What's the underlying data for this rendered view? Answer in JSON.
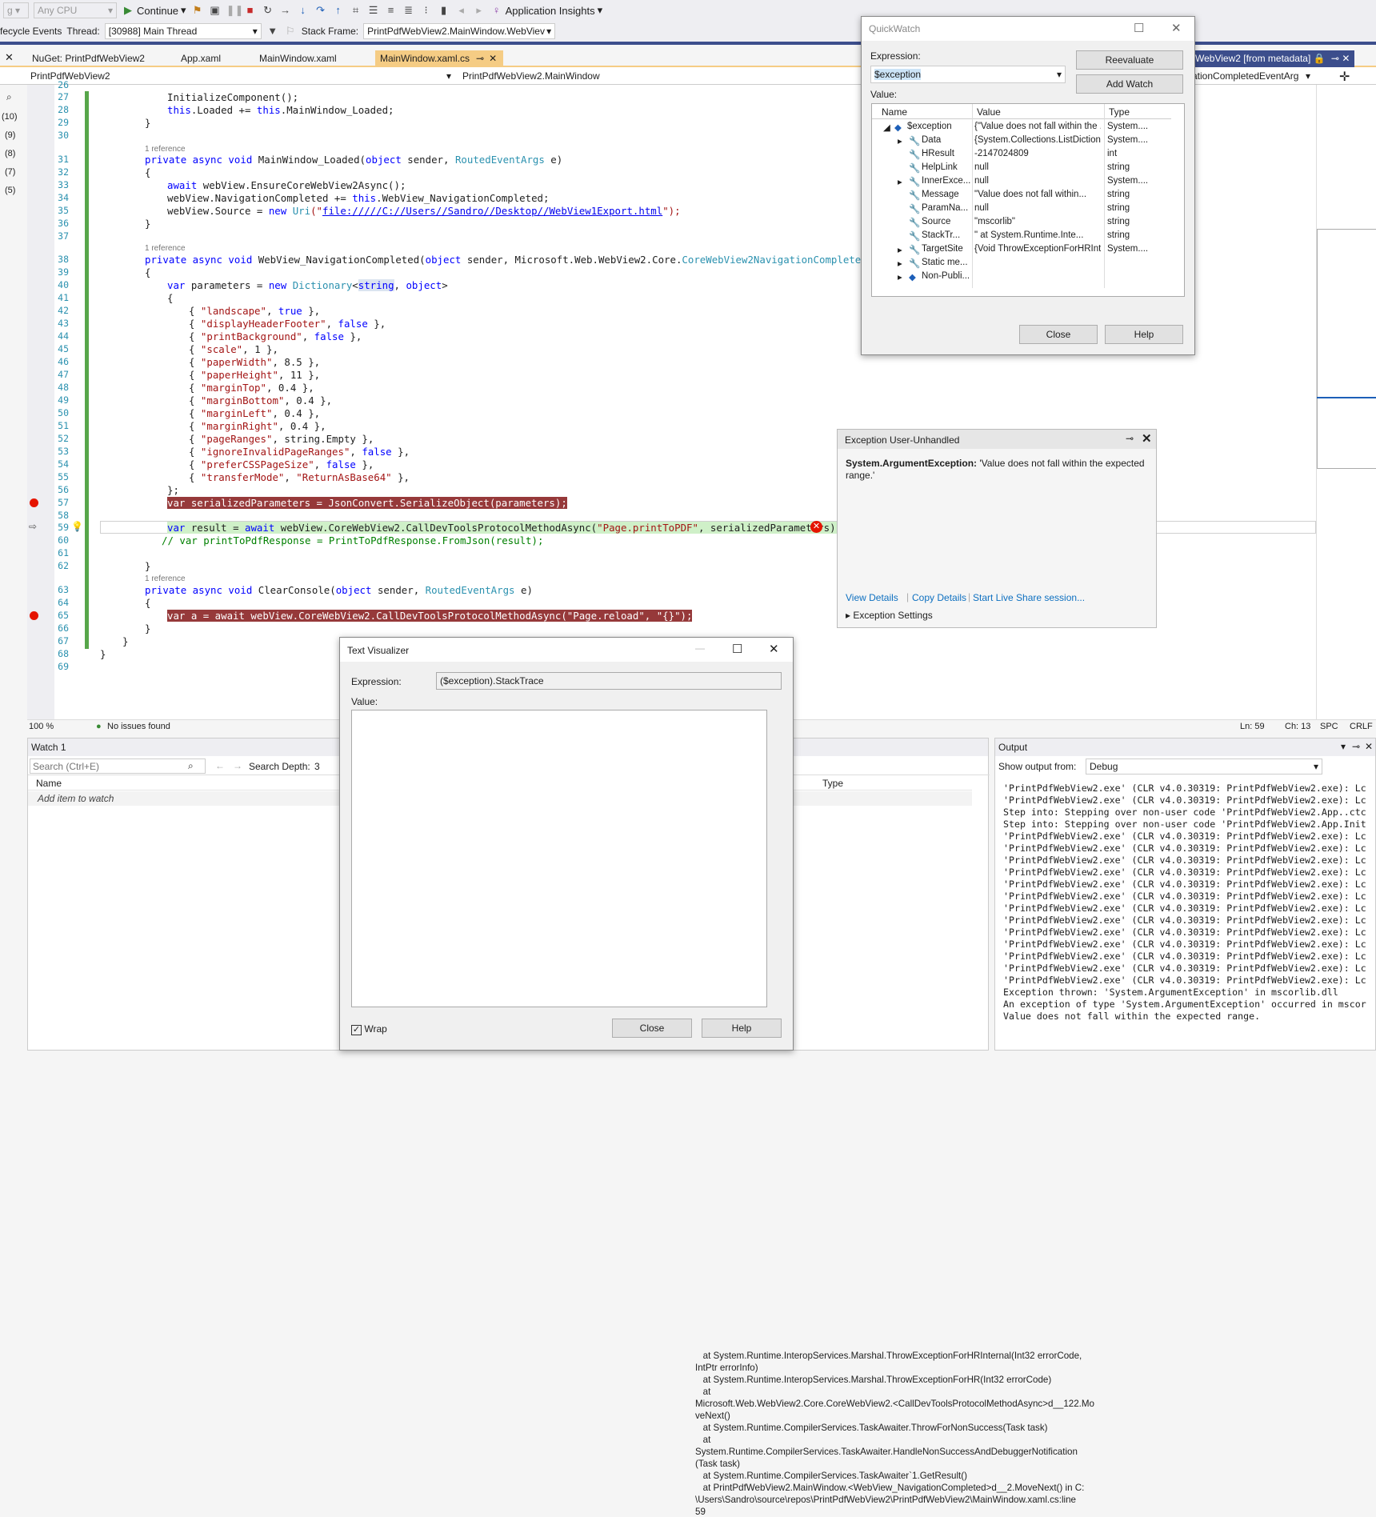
{
  "toolbar": {
    "platform": "Any CPU",
    "continue": "Continue",
    "insights": "Application Insights",
    "lifecycle": "fecycle Events",
    "thread_label": "Thread:",
    "thread_value": "[30988] Main Thread",
    "stackframe_label": "Stack Frame:",
    "stackframe_value": "PrintPdfWebView2.MainWindow.WebViev"
  },
  "tabs": [
    "NuGet: PrintPdfWebView2",
    "App.xaml",
    "MainWindow.xaml",
    "MainWindow.xaml.cs",
    "WebView2 [from metadata]"
  ],
  "navbar": {
    "project": "PrintPdfWebView2",
    "class": "PrintPdfWebView2.MainWindow",
    "member": "ationCompletedEventArg"
  },
  "left_marks": [
    "(10)",
    "(9)",
    "(8)",
    "(7)",
    "(5)"
  ],
  "code": {
    "line_numbers": [
      "26",
      "27",
      "28",
      "29",
      "30",
      "31",
      "32",
      "33",
      "34",
      "35",
      "36",
      "37",
      "38",
      "39",
      "40",
      "41",
      "42",
      "43",
      "44",
      "45",
      "46",
      "47",
      "48",
      "49",
      "50",
      "51",
      "52",
      "53",
      "54",
      "55",
      "56",
      "57",
      "58",
      "59",
      "60",
      "61",
      "62",
      "63",
      "64",
      "65",
      "66",
      "67",
      "68",
      "69"
    ],
    "ref": "1 reference",
    "l27": "InitializeComponent();",
    "l28a": "this",
    "l28b": ".Loaded += ",
    "l28c": "this",
    "l28d": ".MainWindow_Loaded;",
    "brace_open": "{",
    "brace_close": "}",
    "l31a": "private async void",
    "l31b": " MainWindow_Loaded(",
    "l31c": "object",
    "l31d": " sender, ",
    "l31e": "RoutedEventArgs",
    "l31f": " e)",
    "l33a": "await",
    "l33b": " webView.EnsureCoreWebView2Async();",
    "l34a": "webView.NavigationCompleted += ",
    "l34b": "this",
    "l34c": ".WebView_NavigationCompleted;",
    "l35a": "webView.Source = ",
    "l35b": "new",
    "l35c": "Uri",
    "l35d": "(\"",
    "l35e": "file://///C://Users//Sandro//Desktop//WebView1Export.html",
    "l35f": "\");",
    "l38a": "private async void",
    "l38b": " WebView_NavigationCompleted(",
    "l38c": "object",
    "l38d": " sender, Microsoft.Web.WebView2.Core.",
    "l38e": "CoreWebView2NavigationCompletedEventAr",
    "l40a": "var",
    "l40b": " parameters = ",
    "l40c": "new",
    "l40d": "Dictionary",
    "l40e": "<",
    "l40f": "string",
    "l40g": ", ",
    "l40h": "object",
    "l40i": ">",
    "params": [
      {
        "k": "\"landscape\"",
        "v": "true",
        "t": "kw"
      },
      {
        "k": "\"displayHeaderFooter\"",
        "v": "false",
        "t": "kw"
      },
      {
        "k": "\"printBackground\"",
        "v": "false",
        "t": "kw"
      },
      {
        "k": "\"scale\"",
        "v": "1",
        "t": "n"
      },
      {
        "k": "\"paperWidth\"",
        "v": "8.5",
        "t": "n"
      },
      {
        "k": "\"paperHeight\"",
        "v": "11",
        "t": "n"
      },
      {
        "k": "\"marginTop\"",
        "v": "0.4",
        "t": "n"
      },
      {
        "k": "\"marginBottom\"",
        "v": "0.4",
        "t": "n"
      },
      {
        "k": "\"marginLeft\"",
        "v": "0.4",
        "t": "n"
      },
      {
        "k": "\"marginRight\"",
        "v": "0.4",
        "t": "n"
      },
      {
        "k": "\"pageRanges\"",
        "v": "string.Empty",
        "t": "se"
      },
      {
        "k": "\"ignoreInvalidPageRanges\"",
        "v": "false",
        "t": "kw"
      },
      {
        "k": "\"preferCSSPageSize\"",
        "v": "false",
        "t": "kw"
      },
      {
        "k": "\"transferMode\"",
        "v": "\"ReturnAsBase64\"",
        "t": "str"
      }
    ],
    "l56": "};",
    "l57": "var serializedParameters = JsonConvert.SerializeObject(parameters);",
    "l59a": "var",
    "l59b": " result = ",
    "l59c": "await",
    "l59d": " webView.CoreWebView2.CallDevToolsProtocolMethodAsync(",
    "l59e": "\"Page.printToPDF\"",
    "l59f": ", serializedParameters);",
    "l60": "// var printToPdfResponse = PrintToPdfResponse.FromJson(result);",
    "l63a": "private async void",
    "l63b": " ClearConsole(",
    "l63c": "object",
    "l63d": " sender, ",
    "l63e": "RoutedEventArgs",
    "l63f": " e)",
    "l65": "var a = await webView.CoreWebView2.CallDevToolsProtocolMethodAsync(\"Page.reload\", \"{}\");"
  },
  "editor_status": {
    "zoom": "100 %",
    "issues": "No issues found",
    "ln": "Ln: 59",
    "ch": "Ch: 13",
    "spc": "SPC",
    "crlf": "CRLF"
  },
  "watch": {
    "title": "Watch 1",
    "search_placeholder": "Search (Ctrl+E)",
    "depth_label": "Search Depth:",
    "depth": "3",
    "col_name": "Name",
    "col_type": "Type",
    "add_item": "Add item to watch"
  },
  "output": {
    "title": "Output",
    "show_from": "Show output from:",
    "source": "Debug",
    "lines": [
      "'PrintPdfWebView2.exe' (CLR v4.0.30319: PrintPdfWebView2.exe): Lc",
      "'PrintPdfWebView2.exe' (CLR v4.0.30319: PrintPdfWebView2.exe): Lc",
      "Step into: Stepping over non-user code 'PrintPdfWebView2.App..ctc",
      "Step into: Stepping over non-user code 'PrintPdfWebView2.App.Init",
      "'PrintPdfWebView2.exe' (CLR v4.0.30319: PrintPdfWebView2.exe): Lc",
      "'PrintPdfWebView2.exe' (CLR v4.0.30319: PrintPdfWebView2.exe): Lc",
      "'PrintPdfWebView2.exe' (CLR v4.0.30319: PrintPdfWebView2.exe): Lc",
      "'PrintPdfWebView2.exe' (CLR v4.0.30319: PrintPdfWebView2.exe): Lc",
      "'PrintPdfWebView2.exe' (CLR v4.0.30319: PrintPdfWebView2.exe): Lc",
      "'PrintPdfWebView2.exe' (CLR v4.0.30319: PrintPdfWebView2.exe): Lc",
      "'PrintPdfWebView2.exe' (CLR v4.0.30319: PrintPdfWebView2.exe): Lc",
      "'PrintPdfWebView2.exe' (CLR v4.0.30319: PrintPdfWebView2.exe): Lc",
      "'PrintPdfWebView2.exe' (CLR v4.0.30319: PrintPdfWebView2.exe): Lc",
      "'PrintPdfWebView2.exe' (CLR v4.0.30319: PrintPdfWebView2.exe): Lc",
      "'PrintPdfWebView2.exe' (CLR v4.0.30319: PrintPdfWebView2.exe): Lc",
      "'PrintPdfWebView2.exe' (CLR v4.0.30319: PrintPdfWebView2.exe): Lc",
      "'PrintPdfWebView2.exe' (CLR v4.0.30319: PrintPdfWebView2.exe): Lc",
      "Exception thrown: 'System.ArgumentException' in mscorlib.dll",
      "An exception of type 'System.ArgumentException' occurred in mscor",
      "Value does not fall within the expected range."
    ]
  },
  "quickwatch": {
    "title": "QuickWatch",
    "expr_label": "Expression:",
    "expr": "$exception",
    "value_label": "Value:",
    "reevaluate": "Reevaluate",
    "add_watch": "Add Watch",
    "close": "Close",
    "help": "Help",
    "cols": [
      "Name",
      "Value",
      "Type"
    ],
    "rows": [
      {
        "name": "$exception",
        "value": "{\"Value does not fall within the ...",
        "type": "System...."
      },
      {
        "name": "Data",
        "value": "{System.Collections.ListDiction...",
        "type": "System...."
      },
      {
        "name": "HResult",
        "value": "-2147024809",
        "type": "int"
      },
      {
        "name": "HelpLink",
        "value": "null",
        "type": "string"
      },
      {
        "name": "InnerExce...",
        "value": "null",
        "type": "System...."
      },
      {
        "name": "Message",
        "value": "\"Value does not fall within...",
        "type": "string"
      },
      {
        "name": "ParamNa...",
        "value": "null",
        "type": "string"
      },
      {
        "name": "Source",
        "value": "\"mscorlib\"",
        "type": "string"
      },
      {
        "name": "StackTr...",
        "value": "\"   at System.Runtime.Inte...",
        "type": "string"
      },
      {
        "name": "TargetSite",
        "value": "{Void ThrowExceptionForHRInt...",
        "type": "System...."
      },
      {
        "name": "Static me...",
        "value": "",
        "type": ""
      },
      {
        "name": "Non-Publi...",
        "value": "",
        "type": ""
      }
    ]
  },
  "exception_popup": {
    "title": "Exception User-Unhandled",
    "type": "System.ArgumentException:",
    "message": " 'Value does not fall within the expected range.'",
    "view_details": "View Details",
    "copy_details": "Copy Details",
    "live_share": "Start Live Share session...",
    "settings": "Exception Settings"
  },
  "text_visualizer": {
    "title": "Text Visualizer",
    "expr_label": "Expression:",
    "expr": "($exception).StackTrace",
    "value_label": "Value:",
    "lines": [
      "   at System.Runtime.InteropServices.Marshal.ThrowExceptionForHRInternal(Int32 errorCode,",
      "IntPtr errorInfo)",
      "   at System.Runtime.InteropServices.Marshal.ThrowExceptionForHR(Int32 errorCode)",
      "   at",
      "Microsoft.Web.WebView2.Core.CoreWebView2.<CallDevToolsProtocolMethodAsync>d__122.Mo",
      "veNext()",
      "   at System.Runtime.CompilerServices.TaskAwaiter.ThrowForNonSuccess(Task task)",
      "   at",
      "System.Runtime.CompilerServices.TaskAwaiter.HandleNonSuccessAndDebuggerNotification",
      "(Task task)",
      "   at System.Runtime.CompilerServices.TaskAwaiter`1.GetResult()",
      "   at PrintPdfWebView2.MainWindow.<WebView_NavigationCompleted>d__2.MoveNext() in C:",
      "\\Users\\Sandro\\source\\repos\\PrintPdfWebView2\\PrintPdfWebView2\\MainWindow.xaml.cs:line",
      "59"
    ],
    "wrap": "Wrap",
    "close": "Close",
    "help": "Help"
  }
}
